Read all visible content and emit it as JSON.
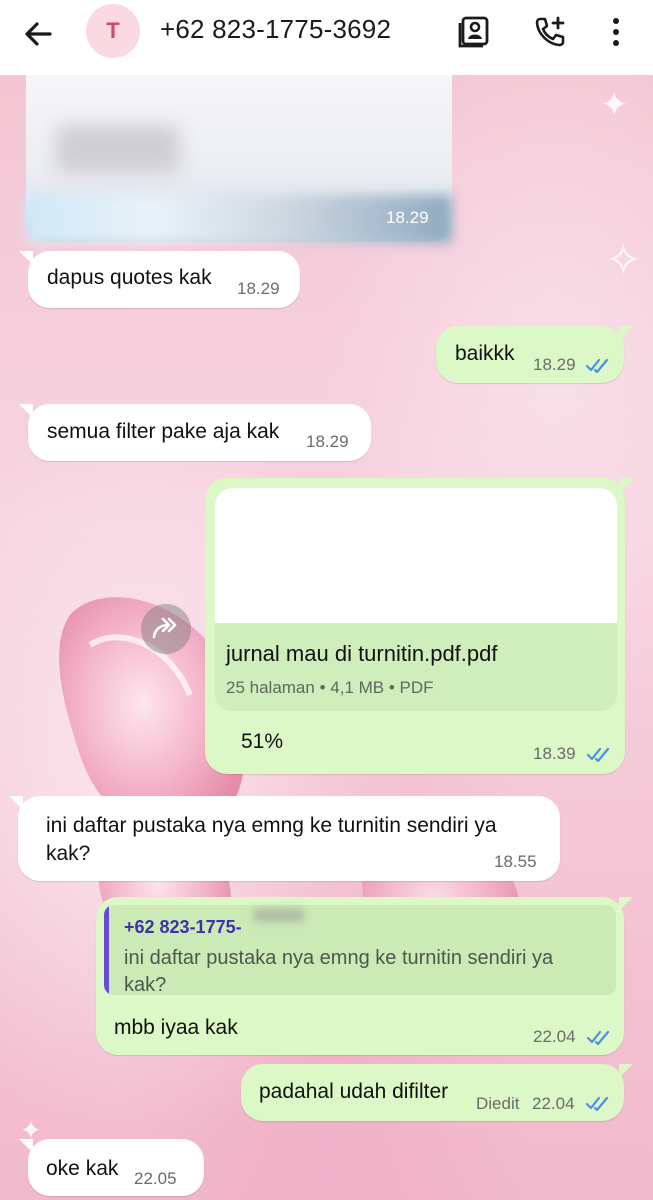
{
  "header": {
    "avatar_letter": "T",
    "contact_name": "+62 823-1775-3692",
    "icons": [
      "back-arrow-icon",
      "contact-card-icon",
      "add-call-icon",
      "more-vert-icon"
    ]
  },
  "colors": {
    "incoming_bubble": "#ffffff",
    "outgoing_bubble": "#dcf8c6",
    "read_ticks": "#4a90e2",
    "avatar_bg": "#fbd9e3",
    "avatar_letter": "#d2466f",
    "quote_bar": "#6a4bd6"
  },
  "messages": [
    {
      "kind": "image",
      "direction": "in",
      "time": "18.29"
    },
    {
      "kind": "text",
      "direction": "in",
      "text": "dapus quotes kak",
      "time": "18.29"
    },
    {
      "kind": "text",
      "direction": "out",
      "text": "baikkk",
      "time": "18.29",
      "status": "read"
    },
    {
      "kind": "text",
      "direction": "in",
      "text": "semua filter pake aja kak",
      "time": "18.29"
    },
    {
      "kind": "document",
      "direction": "out",
      "file_name": "jurnal mau di turnitin.pdf.pdf",
      "pages": "25 halaman",
      "size": "4,1 MB",
      "type": "PDF",
      "caption": "51%",
      "time": "18.39",
      "status": "read"
    },
    {
      "kind": "text",
      "direction": "in",
      "text_line1": "ini daftar pustaka nya emng ke turnitin sendiri ya",
      "text_line2": "kak?",
      "time": "18.55"
    },
    {
      "kind": "reply",
      "direction": "out",
      "quoted_author": "+62 823-1775-",
      "quoted_line1": "ini daftar pustaka nya emng ke turnitin sendiri ya",
      "quoted_line2": "kak?",
      "text": "mbb iyaa kak",
      "time": "22.04",
      "status": "read"
    },
    {
      "kind": "text",
      "direction": "out",
      "text": "padahal udah difilter",
      "edited_label": "Diedit",
      "time": "22.04",
      "status": "read"
    },
    {
      "kind": "text",
      "direction": "in",
      "text": "oke kak",
      "time": "22.05"
    }
  ]
}
